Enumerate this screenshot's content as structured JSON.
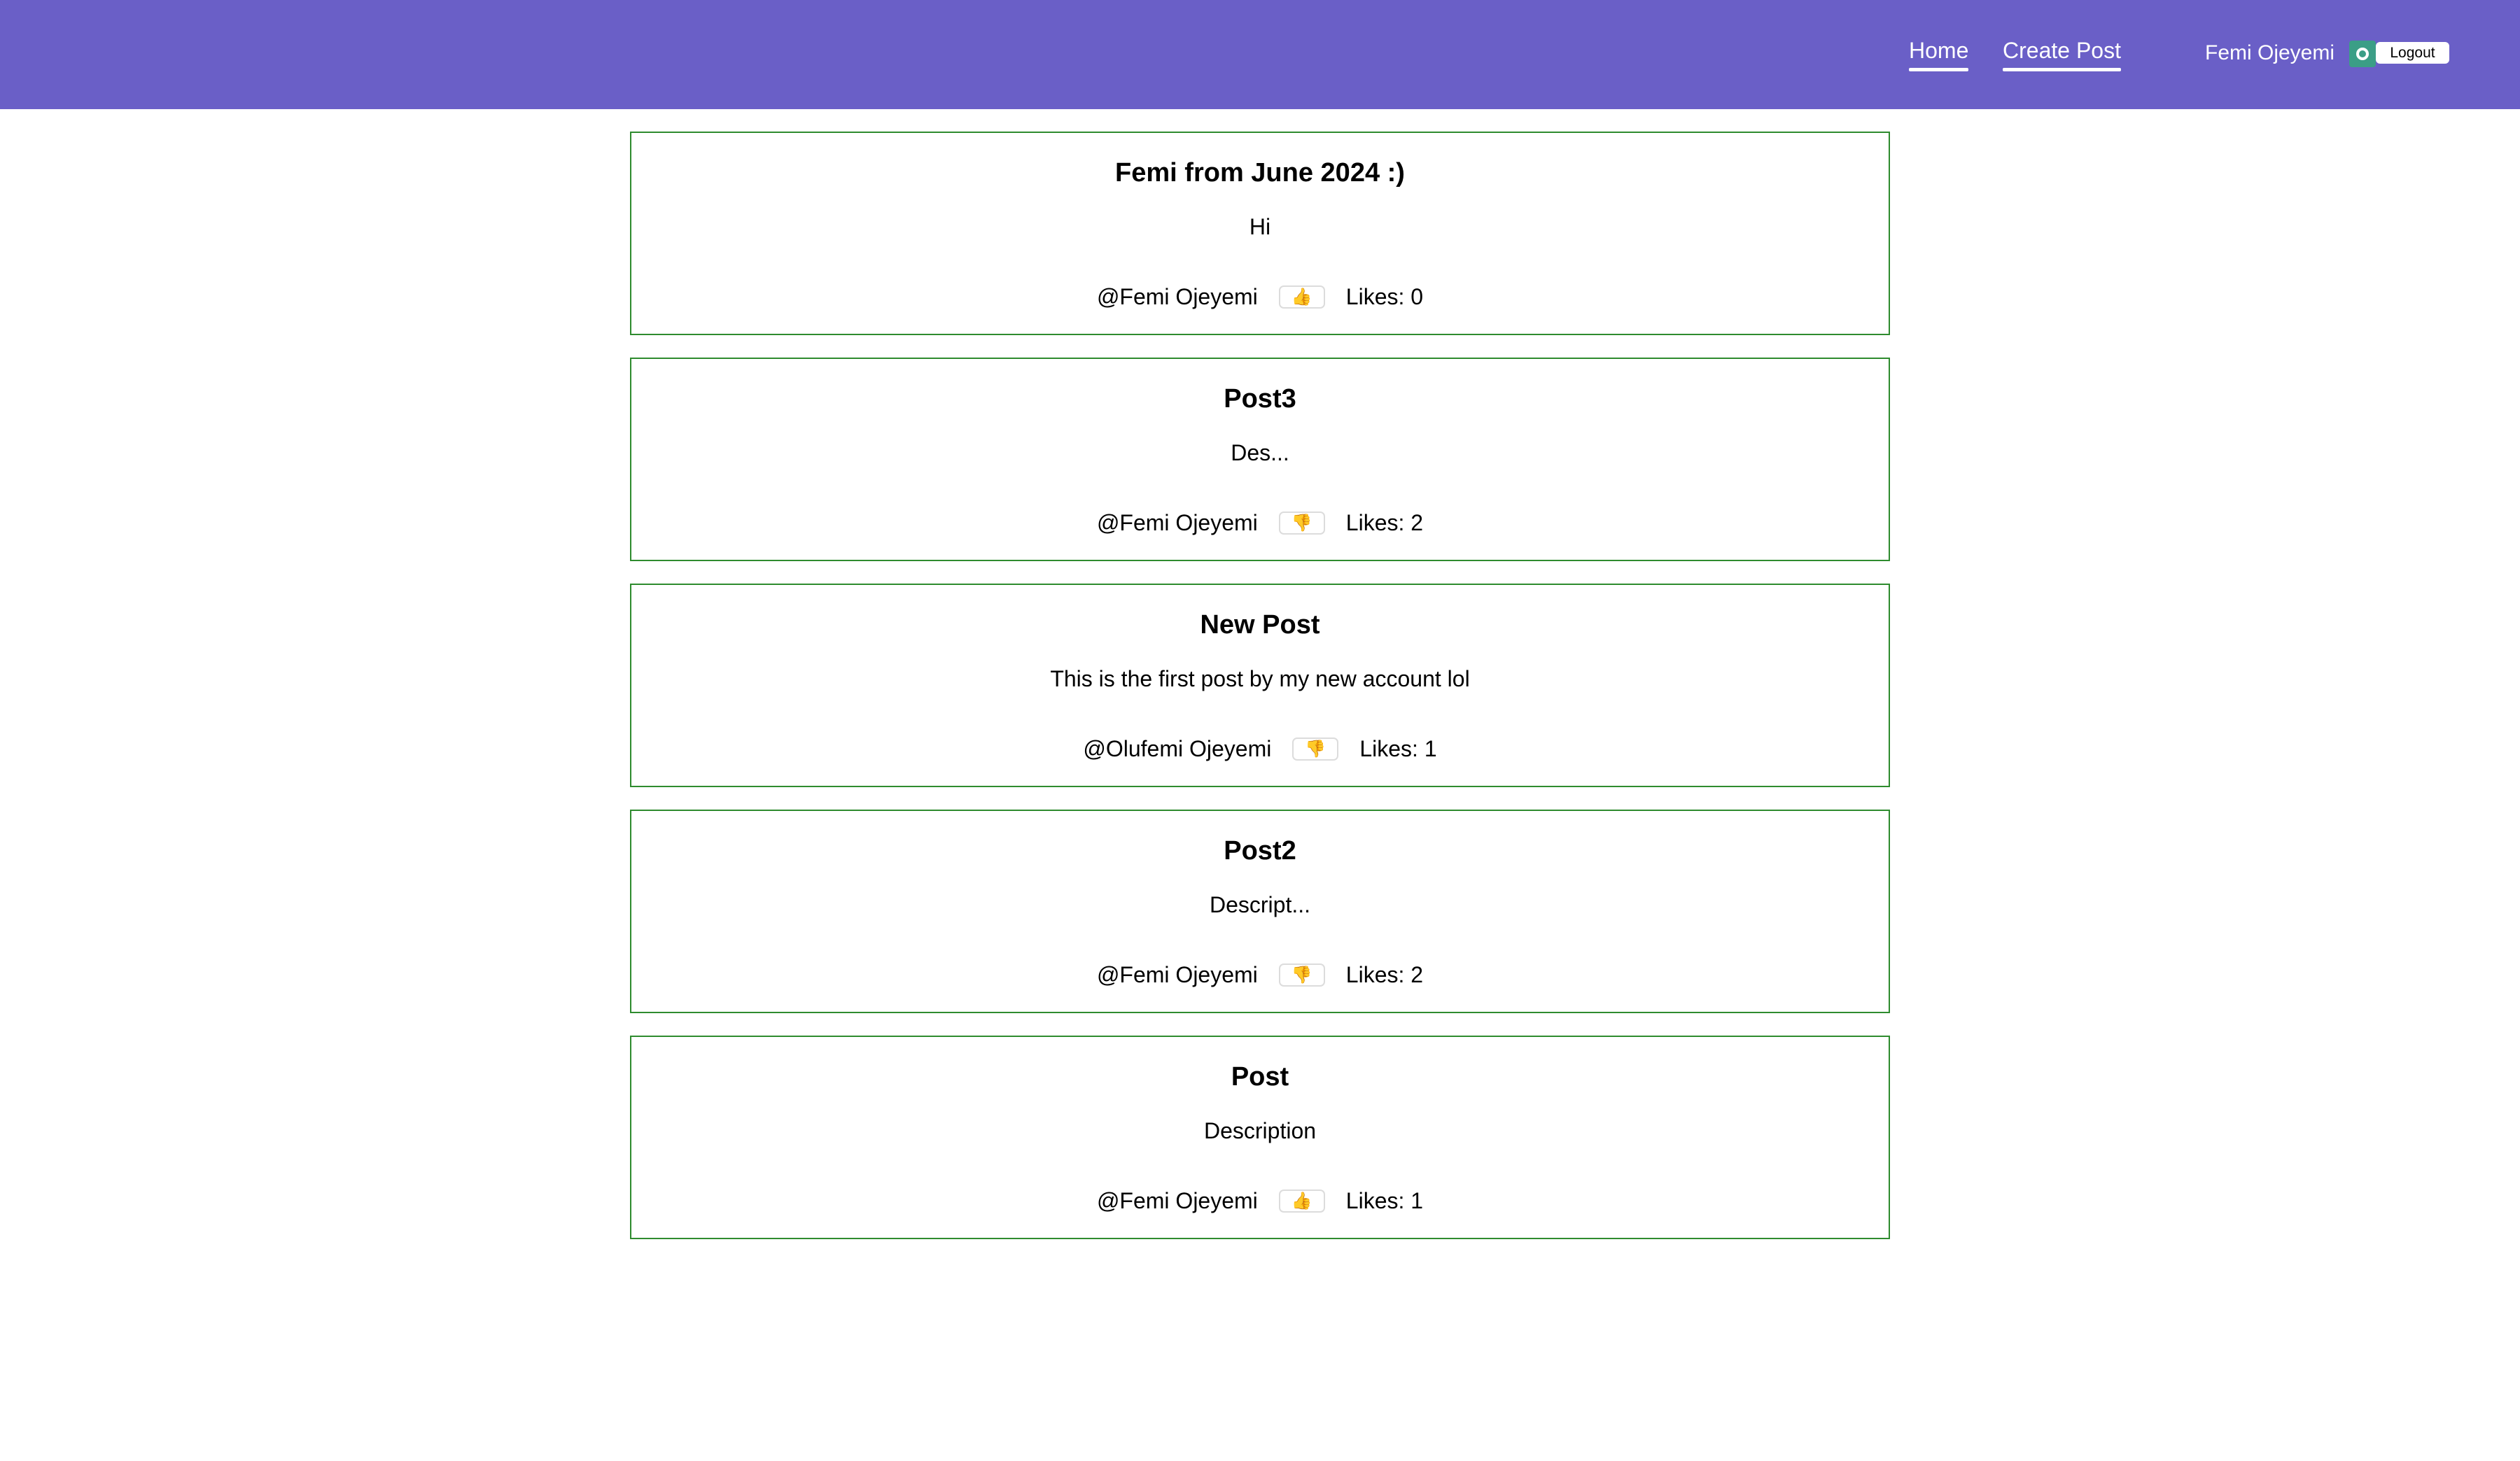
{
  "nav": {
    "home": "Home",
    "create_post": "Create Post",
    "user_name": "Femi Ojeyemi",
    "logout": "Logout",
    "avatar_icon": "user-avatar-icon",
    "bar_color": "#6a5fc7"
  },
  "posts": [
    {
      "title": "Femi from June 2024 :)",
      "body": "Hi",
      "author": "@Femi Ojeyemi",
      "like_icon": "👍",
      "likes": "Likes: 0"
    },
    {
      "title": "Post3",
      "body": "Des...",
      "author": "@Femi Ojeyemi",
      "like_icon": "👎",
      "likes": "Likes: 2"
    },
    {
      "title": "New Post",
      "body": "This is the first post by my new account lol",
      "author": "@Olufemi Ojeyemi",
      "like_icon": "👎",
      "likes": "Likes: 1"
    },
    {
      "title": "Post2",
      "body": "Descript...",
      "author": "@Femi Ojeyemi",
      "like_icon": "👎",
      "likes": "Likes: 2"
    },
    {
      "title": "Post",
      "body": "Description",
      "author": "@Femi Ojeyemi",
      "like_icon": "👍",
      "likes": "Likes: 1"
    }
  ],
  "colors": {
    "card_border": "#2e8b2e",
    "avatar": "#3b9e86"
  }
}
